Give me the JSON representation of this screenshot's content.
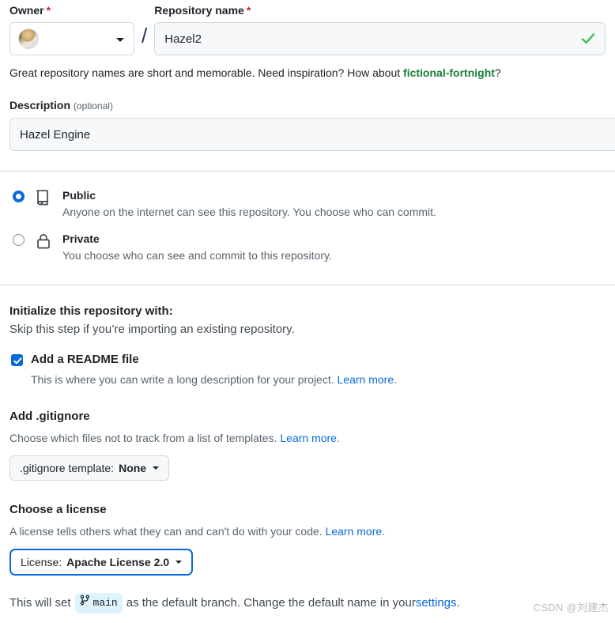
{
  "owner": {
    "label": "Owner",
    "required_mark": "*",
    "avatar_alt": "user-avatar"
  },
  "repository_name": {
    "label": "Repository name",
    "required_mark": "*",
    "value": "Hazel2",
    "placeholder": "",
    "valid": true,
    "separator": "/"
  },
  "name_hint": {
    "before": "Great repository names are short and memorable. Need inspiration? How about ",
    "suggestion": "fictional-fortnight",
    "after": "?"
  },
  "description": {
    "label": "Description",
    "optional_text": "(optional)",
    "value": "Hazel Engine",
    "placeholder": ""
  },
  "visibility": {
    "options": [
      {
        "id": "public",
        "title": "Public",
        "description": "Anyone on the internet can see this repository. You choose who can commit.",
        "icon": "repo-icon",
        "selected": true
      },
      {
        "id": "private",
        "title": "Private",
        "description": "You choose who can see and commit to this repository.",
        "icon": "lock-icon",
        "selected": false
      }
    ]
  },
  "initialize": {
    "title": "Initialize this repository with:",
    "subtitle": "Skip this step if you’re importing an existing repository.",
    "readme": {
      "label": "Add a README file",
      "checked": true,
      "description": "This is where you can write a long description for your project. ",
      "link": "Learn more",
      "link_suffix": "."
    }
  },
  "gitignore": {
    "title": "Add .gitignore",
    "description": "Choose which files not to track from a list of templates. ",
    "link": "Learn more",
    "link_suffix": ".",
    "button_prefix": ".gitignore template: ",
    "button_value": "None"
  },
  "license": {
    "title": "Choose a license",
    "description": "A license tells others what they can and can't do with your code. ",
    "link": "Learn more",
    "link_suffix": ".",
    "button_prefix": "License: ",
    "button_value": "Apache License 2.0",
    "focused": true
  },
  "footer": {
    "before": "This will set",
    "branch": "main",
    "middle": "as the default branch. Change the default name in your ",
    "link": "settings",
    "after": "."
  },
  "watermark": "CSDN @刘建杰",
  "colors": {
    "accent": "#0969da",
    "success": "#1a7f37",
    "required": "#cf222e",
    "muted": "#59636e",
    "border": "#d1d9e0",
    "input_bg": "#f6f8fa",
    "badge_bg": "#ddf4ff"
  }
}
